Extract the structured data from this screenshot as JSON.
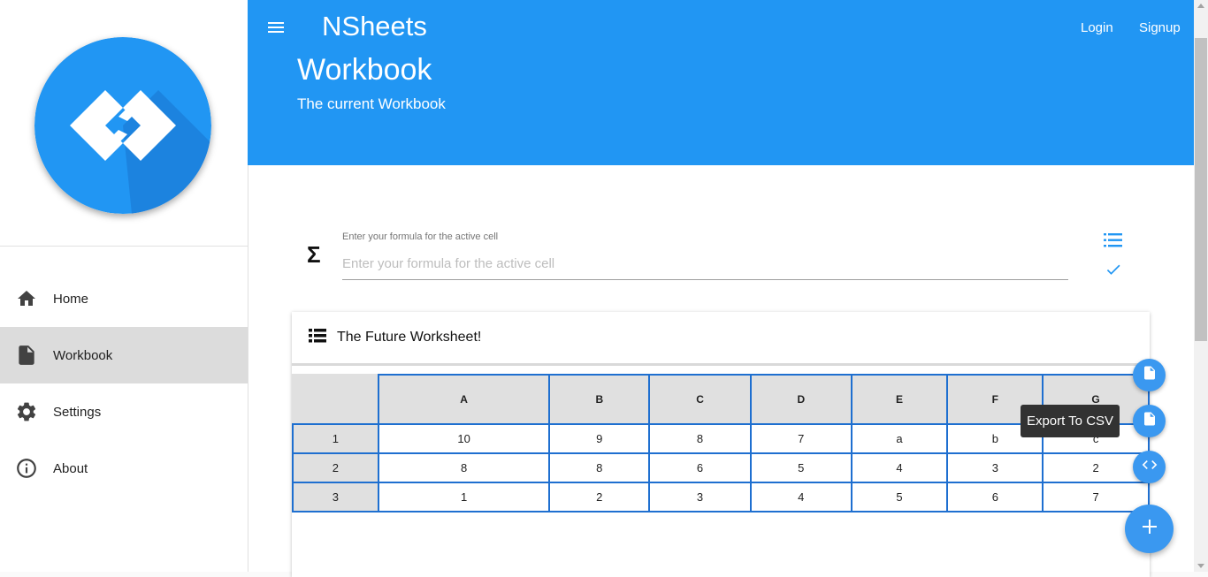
{
  "app": {
    "title": "NSheets"
  },
  "header": {
    "page_title": "Workbook",
    "page_subtitle": "The current Workbook",
    "login_label": "Login",
    "signup_label": "Signup"
  },
  "sidebar": {
    "logo_icon": "code-brackets-logo",
    "items": [
      {
        "label": "Home",
        "icon": "home-icon"
      },
      {
        "label": "Workbook",
        "icon": "file-icon",
        "active": true
      },
      {
        "label": "Settings",
        "icon": "gear-icon"
      },
      {
        "label": "About",
        "icon": "info-icon"
      }
    ]
  },
  "formula": {
    "label": "Enter your formula for the active cell",
    "placeholder": "Enter your formula for the active cell",
    "value": ""
  },
  "worksheet": {
    "title": "The Future Worksheet!",
    "columns": [
      "A",
      "B",
      "C",
      "D",
      "E",
      "F",
      "G"
    ],
    "rows": [
      {
        "num": "1",
        "cells": [
          "10",
          "9",
          "8",
          "7",
          "a",
          "b",
          "c"
        ]
      },
      {
        "num": "2",
        "cells": [
          "8",
          "8",
          "6",
          "5",
          "4",
          "3",
          "2"
        ]
      },
      {
        "num": "3",
        "cells": [
          "1",
          "2",
          "3",
          "4",
          "5",
          "6",
          "7"
        ]
      }
    ]
  },
  "fab": {
    "tooltip": "Export To CSV"
  },
  "colors": {
    "primary": "#2196f3",
    "fab": "#3a98f0",
    "grid_border": "#1e6fd0",
    "active_nav": "#dcdcdc"
  }
}
